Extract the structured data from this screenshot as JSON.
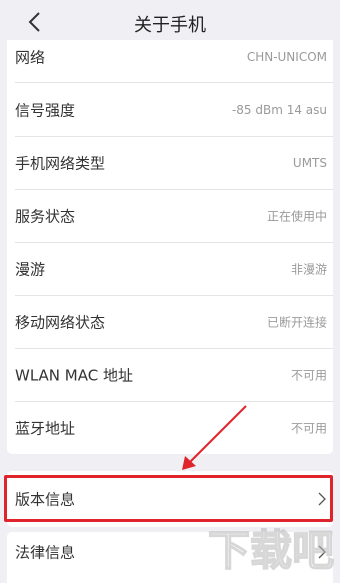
{
  "header": {
    "title": "关于手机",
    "back_icon": "chevron-left-icon"
  },
  "info_rows": [
    {
      "label": "网络",
      "value": "CHN-UNICOM"
    },
    {
      "label": "信号强度",
      "value": "-85 dBm   14 asu"
    },
    {
      "label": "手机网络类型",
      "value": "UMTS"
    },
    {
      "label": "服务状态",
      "value": "正在使用中"
    },
    {
      "label": "漫游",
      "value": "非漫游"
    },
    {
      "label": "移动网络状态",
      "value": "已断开连接"
    },
    {
      "label": "WLAN MAC 地址",
      "value": "不可用"
    },
    {
      "label": "蓝牙地址",
      "value": "不可用"
    }
  ],
  "nav_rows": [
    {
      "label": "版本信息",
      "icon": "chevron-right-icon"
    },
    {
      "label": "法律信息",
      "icon": "chevron-right-icon"
    }
  ],
  "annotations": {
    "highlight_color": "#e0242b",
    "arrow_color": "#e0242b"
  },
  "watermark": {
    "text": "下载吧"
  }
}
